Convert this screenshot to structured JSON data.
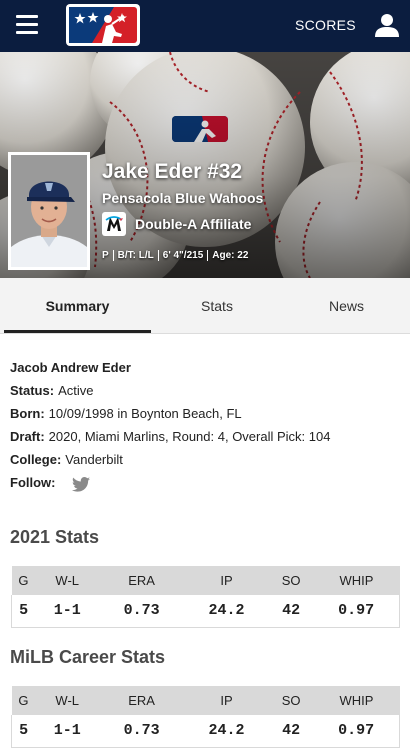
{
  "nav": {
    "scores_label": "SCORES",
    "icons": [
      "hamburger-menu-icon",
      "milb-logo",
      "user-icon"
    ]
  },
  "player": {
    "name_number": "Jake Eder #32",
    "team": "Pensacola Blue Wahoos",
    "affiliate": "Double-A Affiliate",
    "position": "P",
    "bats_throws": "B/T: L/L",
    "height_weight": "6' 4\"/215",
    "age": "Age: 22"
  },
  "tabs": [
    {
      "label": "Summary",
      "active": true
    },
    {
      "label": "Stats",
      "active": false
    },
    {
      "label": "News",
      "active": false
    }
  ],
  "bio": {
    "full_name": "Jacob Andrew Eder",
    "status_label": "Status:",
    "status_value": "Active",
    "born_label": "Born:",
    "born_value": "10/09/1998 in Boynton Beach, FL",
    "draft_label": "Draft:",
    "draft_value": "2020, Miami Marlins, Round: 4, Overall Pick: 104",
    "college_label": "College:",
    "college_value": "Vanderbilt",
    "follow_label": "Follow:"
  },
  "stats_2021": {
    "title": "2021 Stats",
    "headers": [
      "G",
      "W-L",
      "ERA",
      "IP",
      "SO",
      "WHIP"
    ],
    "values": [
      "5",
      "1-1",
      "0.73",
      "24.2",
      "42",
      "0.97"
    ]
  },
  "career_stats": {
    "title": "MiLB Career Stats",
    "headers": [
      "G",
      "W-L",
      "ERA",
      "IP",
      "SO",
      "WHIP"
    ],
    "values": [
      "5",
      "1-1",
      "0.73",
      "24.2",
      "42",
      "0.97"
    ]
  },
  "colors": {
    "nav_bg": "#0b1d3f",
    "tab_bg": "#f3f3f3",
    "table_header_bg": "#d9d9d9",
    "twitter_gray": "#8a8a8a",
    "logo_red": "#d42028",
    "logo_blue": "#0b3a7a"
  }
}
